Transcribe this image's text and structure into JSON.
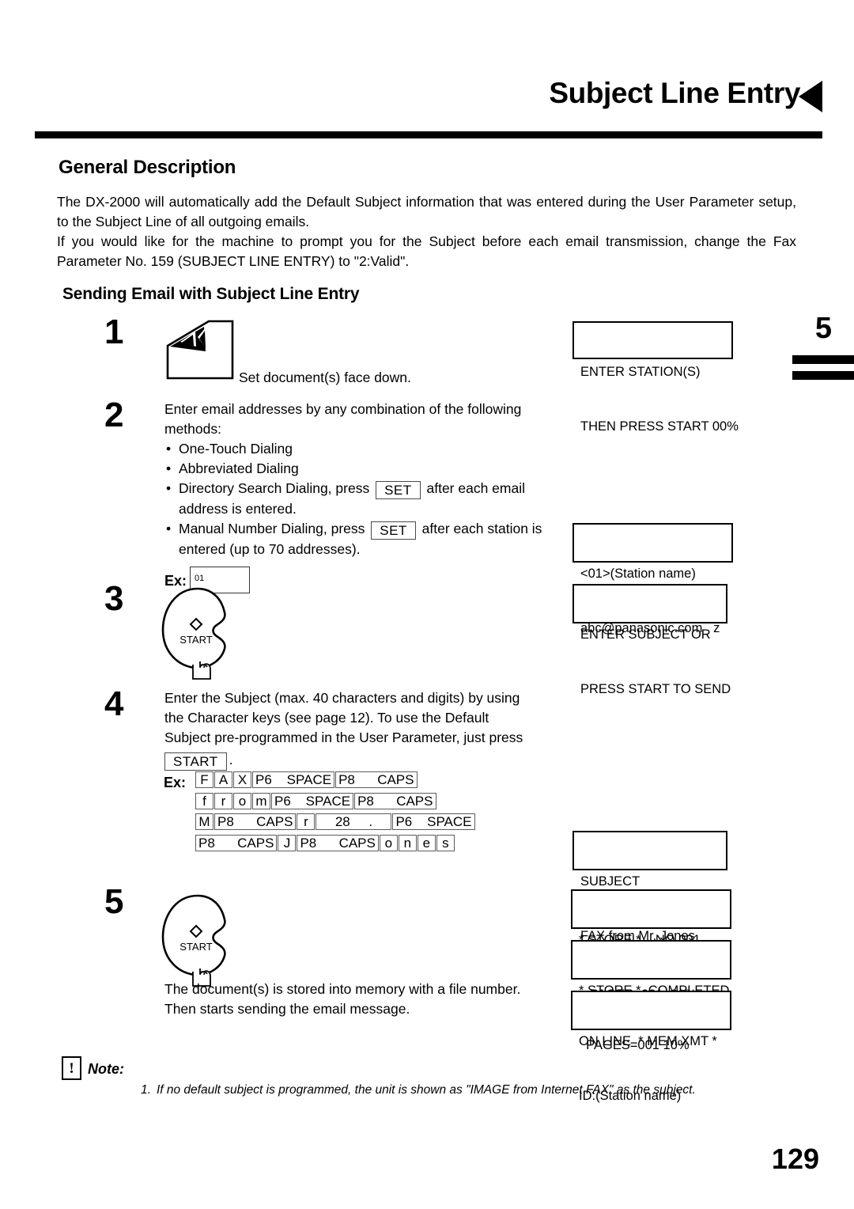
{
  "header": {
    "title": "Subject Line Entry",
    "arrow_icon": "left-triangle-icon"
  },
  "tab_marker": {
    "number": "5"
  },
  "sections": {
    "general_description_heading": "General Description",
    "sending_email_heading": "Sending Email with Subject Line Entry"
  },
  "intro": {
    "paragraph1": "The DX-2000 will automatically add the Default Subject information that was entered during the User Parameter setup, to the Subject Line of all outgoing emails.",
    "paragraph2": "If you would like for the machine to prompt you for the Subject before each email transmission, change the Fax Parameter No. 159 (SUBJECT LINE ENTRY) to \"2:Valid\"."
  },
  "steps": {
    "s1": {
      "number": "1",
      "caption": "Set document(s) face down."
    },
    "s2": {
      "number": "2",
      "intro": "Enter email addresses by any combination of the following methods:",
      "bullets": [
        "One-Touch Dialing",
        "Abbreviated Dialing"
      ],
      "bullet3_pre": "Directory Search Dialing, press",
      "bullet3_key": "SET",
      "bullet3_post": "after each email address is entered.",
      "bullet4_pre": "Manual Number Dialing, press",
      "bullet4_key": "SET",
      "bullet4_post": "after each station is entered (up to 70 addresses).",
      "ex_label": "Ex:",
      "ex_value": "01"
    },
    "s3": {
      "number": "3",
      "key_label": "START"
    },
    "s4": {
      "number": "4",
      "text_line1": "Enter the Subject (max. 40 characters and digits) by using",
      "text_line2": "the Character keys (see page 12).  To use the Default",
      "text_line3": "Subject pre-programmed in the User Parameter, just press",
      "inline_key": "START",
      "trailing_period": ".",
      "ex_label": "Ex:",
      "key_sequence": [
        [
          {
            "t": "F",
            "w": "narrow"
          },
          {
            "t": "A",
            "w": "narrow"
          },
          {
            "t": "X",
            "w": "narrow"
          },
          {
            "t": "P6    SPACE",
            "w": "wide"
          },
          {
            "t": "P8      CAPS",
            "w": "wide"
          }
        ],
        [
          {
            "t": "f",
            "w": "narrow"
          },
          {
            "t": "r",
            "w": "narrow"
          },
          {
            "t": "o",
            "w": "narrow"
          },
          {
            "t": "m",
            "w": "narrow"
          },
          {
            "t": "P6    SPACE",
            "w": "wide"
          },
          {
            "t": "P8      CAPS",
            "w": "wide"
          }
        ],
        [
          {
            "t": "M",
            "w": "narrow"
          },
          {
            "t": "P8      CAPS",
            "w": "wide"
          },
          {
            "t": "r",
            "w": "narrow"
          },
          {
            "t": "28     .",
            "w": "wide"
          },
          {
            "t": "P6    SPACE",
            "w": "wide"
          }
        ],
        [
          {
            "t": "P8      CAPS",
            "w": "wide"
          },
          {
            "t": "J",
            "w": "narrow"
          },
          {
            "t": "P8      CAPS",
            "w": "wide"
          },
          {
            "t": "o",
            "w": "narrow"
          },
          {
            "t": "n",
            "w": "narrow"
          },
          {
            "t": "e",
            "w": "narrow"
          },
          {
            "t": "s",
            "w": "narrow"
          }
        ]
      ]
    },
    "s5": {
      "number": "5",
      "key_label": "START",
      "text_line1": "The document(s) is stored into memory with a file number.",
      "text_line2": "Then starts sending the email message."
    }
  },
  "lcd_displays": [
    {
      "id": "enter-stations",
      "line1": "ENTER STATION(S)",
      "line2": "THEN PRESS START 00%"
    },
    {
      "id": "station-address",
      "line1": "<01>(Station name)",
      "line2": "abc@panasonic.com   z"
    },
    {
      "id": "enter-subject",
      "line1": "ENTER SUBJECT OR",
      "line2": "PRESS START TO SEND"
    },
    {
      "id": "subject-entered",
      "line1": "SUBJECT",
      "line2": "FAX from Mr. Jones"
    },
    {
      "id": "store-progress",
      "line1": "* STORE *    NO.001",
      "line2": "   PAGES=001  01%"
    },
    {
      "id": "store-completed",
      "line1": "* STORE *  COMPLETED",
      "line2": "  PAGES=001 10%"
    },
    {
      "id": "on-line",
      "line1": "ON LINE  * MEM.XMT *",
      "line2": "ID:(Station name)"
    }
  ],
  "note": {
    "icon": "exclamation-icon",
    "glyph": "!",
    "label": "Note:",
    "items": [
      {
        "number": "1.",
        "text": "If no default subject is programmed, the unit is shown as \"IMAGE from Internet FAX\" as the subject."
      }
    ]
  },
  "page_number": "129"
}
